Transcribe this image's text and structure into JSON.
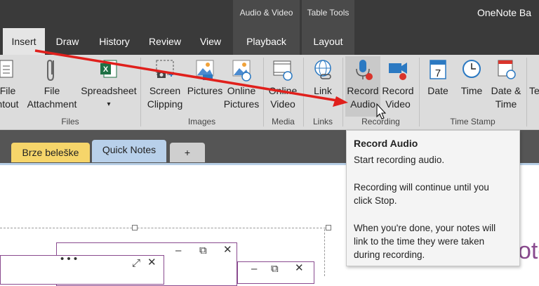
{
  "title_bar": {
    "app_title": "OneNote Ba",
    "context_groups": [
      "Audio & Video",
      "Table Tools"
    ]
  },
  "ribbon_tabs": [
    {
      "label": "Insert"
    },
    {
      "label": "Draw"
    },
    {
      "label": "History"
    },
    {
      "label": "Review"
    },
    {
      "label": "View"
    },
    {
      "label": "Playback"
    },
    {
      "label": "Layout"
    }
  ],
  "ribbon": {
    "buttons": {
      "file_printout": [
        "File",
        "ntout"
      ],
      "file_attachment": [
        "File",
        "Attachment"
      ],
      "spreadsheet": [
        "Spreadsheet",
        "▾"
      ],
      "screen_clipping": [
        "Screen",
        "Clipping"
      ],
      "pictures": [
        "Pictures",
        ""
      ],
      "online_pictures": [
        "Online",
        "Pictures"
      ],
      "online_video": [
        "Online",
        "Video"
      ],
      "link": [
        "Link",
        ""
      ],
      "record_audio": [
        "Record",
        "Audio"
      ],
      "record_video": [
        "Record",
        "Video"
      ],
      "date": [
        "Date",
        ""
      ],
      "time": [
        "Time",
        ""
      ],
      "date_time": [
        "Date &",
        "Time"
      ],
      "te": [
        "Te",
        ""
      ]
    },
    "groups": {
      "files": "Files",
      "images": "Images",
      "media": "Media",
      "links": "Links",
      "recording": "Recording",
      "time_stamp": "Time Stamp"
    }
  },
  "sections": [
    {
      "label": "Brze beleške",
      "color": "#f6d56a"
    },
    {
      "label": "Quick Notes",
      "color": "#b8d0ea"
    },
    {
      "label": "+",
      "color": "#cfcfcf"
    }
  ],
  "tooltip": {
    "title": "Record Audio",
    "line1": "Start recording audio.",
    "line2a": "Recording will continue until you",
    "line2b": "click Stop.",
    "line3a": "When you're done, your notes will",
    "line3b": "link to the time they were taken",
    "line3c": "during recording."
  },
  "page": {
    "partial_text": "ote"
  },
  "colors": {
    "titlebar": "#3a3a3a",
    "ribbon": "#dcdcdc",
    "arrow": "#e0201c",
    "note_frame": "#8a4b8f"
  }
}
